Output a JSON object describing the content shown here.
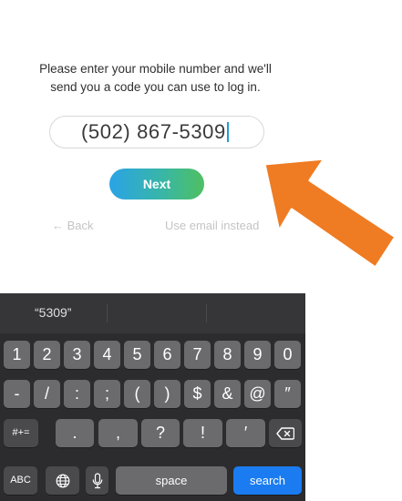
{
  "instructions": {
    "line1": "Please enter your mobile number and we'll",
    "line2": "send you a code you can use to log in."
  },
  "phone_input": {
    "value": "(502) 867-5309"
  },
  "actions": {
    "next_label": "Next",
    "back_label": "← Back",
    "email_label": "Use email instead"
  },
  "keyboard": {
    "suggestion": "“5309”",
    "row1": [
      "1",
      "2",
      "3",
      "4",
      "5",
      "6",
      "7",
      "8",
      "9",
      "0"
    ],
    "row2": [
      "-",
      "/",
      ":",
      ";",
      "(",
      ")",
      "$",
      "&",
      "@",
      "″"
    ],
    "row3": {
      "symbols_toggle": "#+=",
      "keys": [
        ".",
        ",",
        "?",
        "!",
        "′"
      ],
      "delete_icon": "backspace-icon"
    },
    "row4": {
      "abc": "ABC",
      "globe_icon": "globe-icon",
      "mic_icon": "microphone-icon",
      "space": "space",
      "search": "search"
    }
  },
  "colors": {
    "accent_blue": "#1a7cf0",
    "arrow_orange": "#ef7b22",
    "gradient_start": "#2aa3e6",
    "gradient_end": "#4fc062"
  }
}
